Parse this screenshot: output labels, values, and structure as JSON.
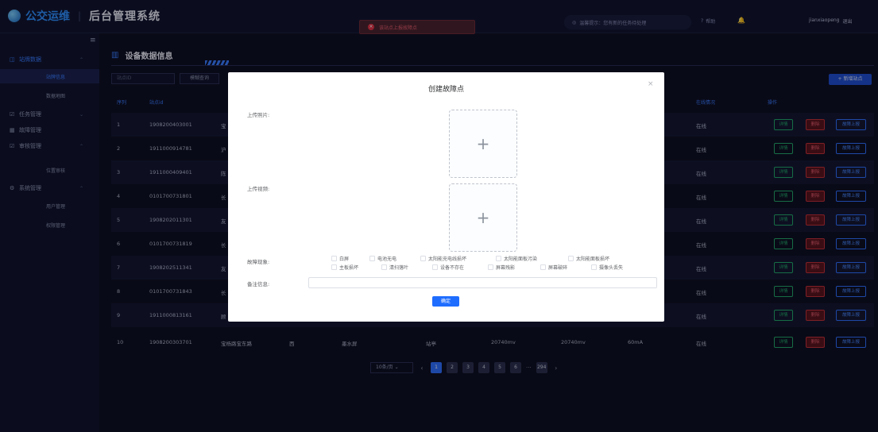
{
  "header": {
    "brand": "公交运维",
    "separator": "|",
    "system": "后台管理系统",
    "toast": "该站点上报故障点",
    "notice": "温馨提示：您有新的任务待处理",
    "help": "帮助",
    "user": "jianxiaopeng",
    "logout": "退出"
  },
  "sidebar": {
    "groups": [
      {
        "label": "站牌数据",
        "children": [
          "站牌信息",
          "数据地图"
        ]
      },
      {
        "label": "任务管理"
      },
      {
        "label": "故障管理"
      },
      {
        "label": "审核管理",
        "children": [
          "位置审核"
        ]
      },
      {
        "label": "系统管理",
        "children": [
          "用户管理",
          "权限管理"
        ]
      }
    ]
  },
  "page": {
    "title": "设备数据信息",
    "filter_placeholder": "站点ID",
    "filter_button": "模糊查询",
    "add_button": "+ 新增站点",
    "columns": {
      "index": "序列",
      "id": "站点id",
      "status": "在线情况",
      "ops": "操作"
    },
    "actions": {
      "detail": "详情",
      "delete": "删除",
      "report": "故障上报"
    }
  },
  "rows": [
    {
      "index": "1",
      "id": "1908200403001",
      "name": "宝",
      "status": "在线"
    },
    {
      "index": "2",
      "id": "1911000914781",
      "name": "沪",
      "status": "在线"
    },
    {
      "index": "3",
      "id": "1911000409401",
      "name": "陈",
      "status": "在线"
    },
    {
      "index": "4",
      "id": "0101700731801",
      "name": "长",
      "status": "在线"
    },
    {
      "index": "5",
      "id": "1908202011301",
      "name": "友",
      "status": "在线"
    },
    {
      "index": "6",
      "id": "0101700731819",
      "name": "长",
      "status": "在线"
    },
    {
      "index": "7",
      "id": "1908202511341",
      "name": "友",
      "status": "在线"
    },
    {
      "index": "8",
      "id": "0101700731843",
      "name": "长",
      "status": "在线"
    },
    {
      "index": "9",
      "id": "1911000813161",
      "name": "顾",
      "status": "在线"
    },
    {
      "index": "10",
      "id": "1908200303701",
      "name": "宝杨路宝东路",
      "dir": "西",
      "screen": "墨水屏",
      "type": "站亭",
      "v1": "20740mv",
      "v2": "20740mv",
      "cur": "60mA",
      "status": "在线"
    }
  ],
  "pagination": {
    "size": "10条/页",
    "pages": [
      "1",
      "2",
      "3",
      "4",
      "5",
      "6"
    ],
    "dots": "···",
    "last": "294"
  },
  "modal": {
    "title": "创建故障点",
    "photo_label": "上传照片:",
    "video_label": "上传视频:",
    "plus": "+",
    "symptom_label": "故障现象:",
    "symptoms_row1": [
      "白屏",
      "电池无电",
      "太阳能充电线损坏",
      "太阳能面板污染",
      "太阳能面板损坏"
    ],
    "symptoms_row2": [
      "主板损坏",
      "清扫落叶",
      "设备不存在",
      "屏幕残影",
      "屏幕破碎",
      "摄像头丢失"
    ],
    "remark_label": "备注信息:",
    "confirm": "确定",
    "close": "×"
  },
  "colors": {
    "accent": "#2f6fff",
    "success": "#23a86a",
    "danger": "#c0303a",
    "bg": "#0b0d1a"
  }
}
